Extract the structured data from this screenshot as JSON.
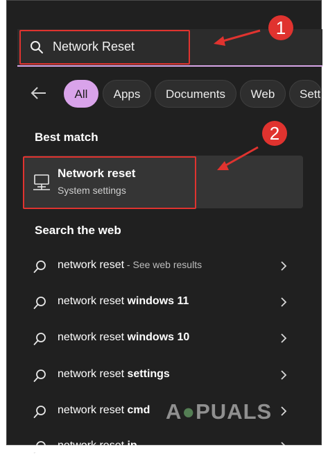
{
  "search": {
    "value": "Network Reset"
  },
  "filters": [
    "All",
    "Apps",
    "Documents",
    "Web",
    "Settings"
  ],
  "sections": {
    "best_match": "Best match",
    "search_web": "Search the web"
  },
  "best_match": {
    "title": "Network reset",
    "subtitle": "System settings",
    "icon": "monitor-network-icon"
  },
  "web_results": [
    {
      "prefix": "network reset",
      "bold": "",
      "suffix": " - See web results"
    },
    {
      "prefix": "network reset ",
      "bold": "windows 11",
      "suffix": ""
    },
    {
      "prefix": "network reset ",
      "bold": "windows 10",
      "suffix": ""
    },
    {
      "prefix": "network reset ",
      "bold": "settings",
      "suffix": ""
    },
    {
      "prefix": "network reset ",
      "bold": "cmd",
      "suffix": ""
    },
    {
      "prefix": "network reset ",
      "bold": "ip",
      "suffix": ""
    }
  ],
  "annotations": {
    "step1": "1",
    "step2": "2"
  },
  "watermark": "APPUALS",
  "colors": {
    "accent": "#d9a3ea",
    "annotation": "#e0332f",
    "background": "#202020"
  }
}
